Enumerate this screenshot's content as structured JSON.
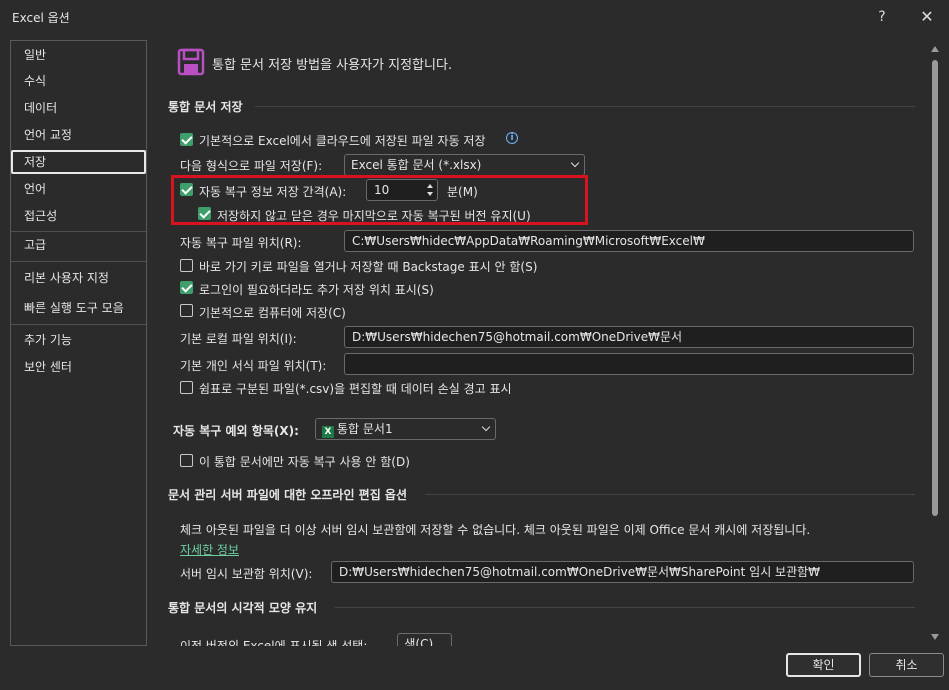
{
  "window": {
    "title": "Excel 옵션",
    "help": "?",
    "close": "✕"
  },
  "sidebar": {
    "items": [
      {
        "label": "일반"
      },
      {
        "label": "수식"
      },
      {
        "label": "데이터"
      },
      {
        "label": "언어 교정"
      },
      {
        "label": "저장",
        "selected": true
      },
      {
        "label": "언어"
      },
      {
        "label": "접근성"
      },
      {
        "label": "고급"
      },
      {
        "label": "리본 사용자 지정"
      },
      {
        "label": "빠른 실행 도구 모음"
      },
      {
        "label": "추가 기능"
      },
      {
        "label": "보안 센터"
      }
    ]
  },
  "header": {
    "text": "통합 문서 저장 방법을 사용자가 지정합니다.",
    "icon": "save-icon"
  },
  "section_save": {
    "title": "통합 문서 저장",
    "autosave_cloud": {
      "label": "기본적으로 Excel에서 클라우드에 저장된 파일 자동 저장",
      "checked": true
    },
    "save_format_label": "다음 형식으로 파일 저장(F):",
    "save_format_value": "Excel 통합 문서 (*.xlsx)",
    "autorecover": {
      "label": "자동 복구 정보 저장 간격(A):",
      "checked": true
    },
    "autorecover_minutes": "10",
    "minutes_label": "분(M)",
    "keep_last": {
      "label": "저장하지 않고 닫은 경우 마지막으로 자동 복구된 버전 유지(U)",
      "checked": true
    },
    "autorecover_location_label": "자동 복구 파일 위치(R):",
    "autorecover_location_value": "C:₩Users₩hidec₩AppData₩Roaming₩Microsoft₩Excel₩",
    "backstage": {
      "label": "바로 가기 키로 파일을 열거나 저장할 때 Backstage 표시 안 함(S)",
      "checked": false
    },
    "show_additional": {
      "label": "로그인이 필요하더라도 추가 저장 위치 표시(S)",
      "checked": true
    },
    "save_to_computer": {
      "label": "기본적으로 컴퓨터에 저장(C)",
      "checked": false
    },
    "default_local_label": "기본 로컬 파일 위치(I):",
    "default_local_value": "D:₩Users₩hidechen75@hotmail.com₩OneDrive₩문서",
    "personal_templates_label": "기본 개인 서식 파일 위치(T):",
    "personal_templates_value": "",
    "csv_warning": {
      "label": "쉼표로 구분된 파일(*.csv)을 편집할 때 데이터 손실 경고 표시",
      "checked": false
    }
  },
  "section_exceptions": {
    "label": "자동 복구 예외 항목(X):",
    "workbook_value": "통합 문서1",
    "disable_autorecover": {
      "label": "이 통합 문서에만 자동 복구 사용 안 함(D)",
      "checked": false
    }
  },
  "section_offline": {
    "title": "문서 관리 서버 파일에 대한 오프라인 편집 옵션",
    "description": "체크 아웃된 파일을 더 이상 서버 임시 보관함에 저장할 수 없습니다. 체크 아웃된 파일은 이제 Office 문서 캐시에 저장됩니다.",
    "link": "자세한 정보",
    "drafts_label": "서버 임시 보관함 위치(V):",
    "drafts_value": "D:₩Users₩hidechen75@hotmail.com₩OneDrive₩문서₩SharePoint 임시 보관함₩"
  },
  "section_visual": {
    "title": "통합 문서의 시각적 모양 유지",
    "colors_label": "이전 버전의 Excel에 표시될 색 선택:",
    "colors_button": "색(C)..."
  },
  "footer": {
    "ok": "확인",
    "cancel": "취소"
  },
  "colors": {
    "accent_green": "#3f9f6a",
    "highlight_red": "#d9121f",
    "link": "#6fcfa0"
  }
}
